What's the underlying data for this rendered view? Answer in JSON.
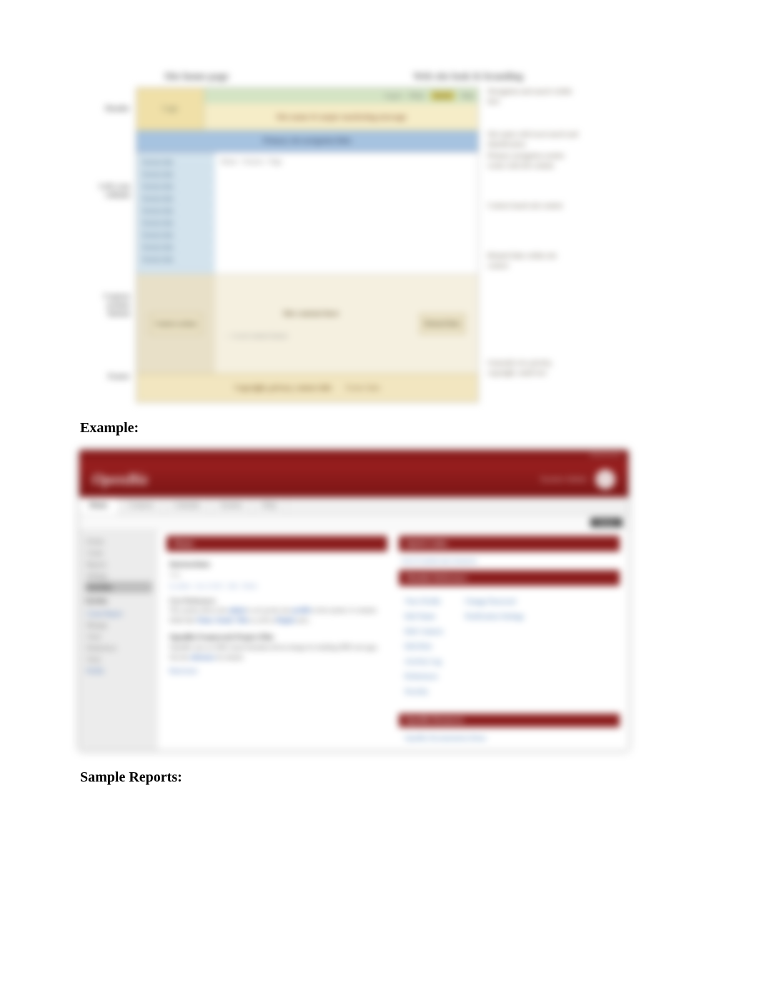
{
  "diagram": {
    "top_labels": {
      "left": "Site home page",
      "right": "Web site look & branding"
    },
    "side": {
      "header": "Header",
      "scan": "Left scan column",
      "context": "Context actions button",
      "footer": "Footer"
    },
    "header_links": [
      "Log in",
      "FAQs",
      "Search",
      "Help"
    ],
    "header_banner": "Site name & major marketing message",
    "top_nav": "Primary site navigation links",
    "menu_items": [
      "Section link",
      "Section link",
      "Section link",
      "Section link",
      "Section link",
      "Section link",
      "Section link",
      "Section link",
      "Section link"
    ],
    "crumbs": "Home > Section > Page",
    "lower": {
      "btn": "Context actions",
      "mid": "Site content here",
      "sub": "— Local content feature",
      "rightbtn": "Related links"
    },
    "footer": {
      "copy": "Copyright, privacy, contact info",
      "links": "Footer links"
    },
    "annot": {
      "a1": "Navigation and search visible here",
      "a2": "Site name with local search and identification",
      "a3": "Primary navigation system works with left column",
      "a4": "Context based sub content",
      "a5": "Related links within site context",
      "a6": "Generally low priority, copyright, small text"
    }
  },
  "headings": {
    "example": "Example:",
    "sample_reports": "Sample Reports:"
  },
  "app": {
    "topbar": "Administrator",
    "logo": "OpenBiz",
    "user": "System Admin",
    "tabs": [
      "Home",
      "Contacts",
      "Calendar",
      "System",
      "Help"
    ],
    "chip": "Admin",
    "sidebar": {
      "grp1_items": [
        "Events",
        "Create",
        "Reports",
        "Settings",
        "Activities"
      ],
      "grp2_title": "System",
      "grp2_items": [
        "Create Report",
        "Manage",
        "Users",
        "Preferences",
        "Tools",
        "Profile"
      ]
    },
    "left_panel": {
      "hdr": "Home",
      "title": "Instructions",
      "tag": "Help",
      "datelinks": "by admin · Jan 12 2015 · Edit · Delete",
      "para_label": "User Preferences",
      "para": "The system allows the <b>admin</b> to set up the user <b>profile</b> in the system. It contains fields like <b>Name</b>, <b>Email</b>, <b>Title</b> as well as <b>Region</b> and...",
      "h2": "OpenBiz Framework Project Files",
      "para2": "OpenBiz uses an XML based metadata driven design for building PHP web apps. See the <b>reference</b> for details.",
      "readmore": "Read more"
    },
    "right_panel": {
      "hdr": "Quick Links",
      "sub": "List of current user resources",
      "hdr2": "Module Reference",
      "links_left": [
        "View Profile",
        "Edit Name",
        "Edit Contacts",
        "Edit Role",
        "Activity Log",
        "Preferences",
        "Security"
      ],
      "links_right": [
        "Change Password",
        "Notification Settings"
      ],
      "refhdr": "OpenBiz Resources",
      "reflink": "OpenBiz Documentation Home"
    }
  }
}
